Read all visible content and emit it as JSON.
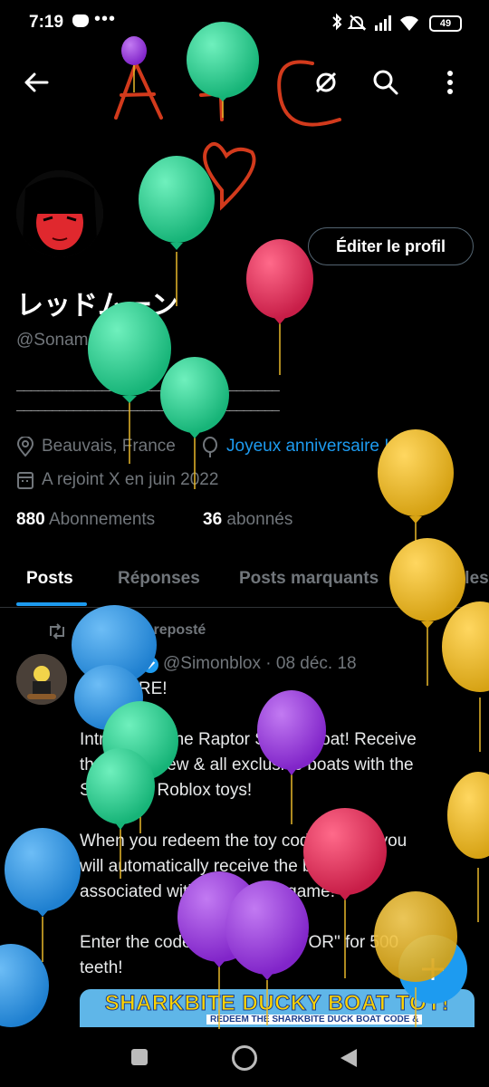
{
  "status_bar": {
    "time": "7:19",
    "dots": "•••",
    "battery": "49"
  },
  "profile": {
    "display_name": "レッドムーン",
    "handle": "@Sonamael1",
    "bio_line_1": "_____________________________________",
    "bio_line_2": "_____________________________________",
    "location": "Beauvais, France",
    "birthday_link": "Joyeux anniversaire !",
    "joined": "A rejoint X en juin 2022",
    "following_count": "880",
    "following_label": "Abonnements",
    "followers_count": "36",
    "followers_label": "abonnés",
    "edit_button": "Éditer le profil"
  },
  "drawing": {
    "scrawl_text": "A+C"
  },
  "tabs": [
    {
      "label": "Posts"
    },
    {
      "label": "Réponses"
    },
    {
      "label": "Posts marquants"
    },
    {
      "label": "Articles"
    }
  ],
  "post": {
    "repost_label": "Vous avez reposté",
    "author_name": "Simon",
    "author_handle_date": "@Simonblox · 08 déc. 18",
    "lines": [
      "IT'S HERE!",
      "",
      "Introducing the Raptor Speed Boat! Receive",
      "the brand new & all exclusive boats with the",
      "Sharkbite Roblox toys!",
      "",
      "When you redeem the toy code online, you",
      "will automatically receive the boat",
      "associated with your toy in-game!",
      "",
      "Enter the code \"DUCKYRAPTOR\" for 500",
      "teeth!"
    ],
    "image_title": "SHARKBITE DUCKY BOAT TOY!",
    "image_subtitle": "REDEEM THE SHARKBITE DUCK BOAT CODE &"
  },
  "icons": {
    "back": "arrow-left-icon",
    "hidden": "eye-off-icon",
    "search": "search-icon",
    "more": "more-vertical-icon",
    "location": "location-pin-icon",
    "balloon": "balloon-icon",
    "calendar": "calendar-icon",
    "repost": "repost-icon",
    "verified": "verified-badge-icon",
    "compose": "plus-icon"
  },
  "colors": {
    "accent": "#1d9bf0",
    "muted": "#71767b",
    "background": "#000000",
    "balloon_green": "#2fd08f",
    "balloon_red": "#e0335a",
    "balloon_yellow": "#e8b82a",
    "balloon_blue": "#2b95e6",
    "balloon_purple": "#9b3de0",
    "scrawl": "#d23a1c"
  }
}
